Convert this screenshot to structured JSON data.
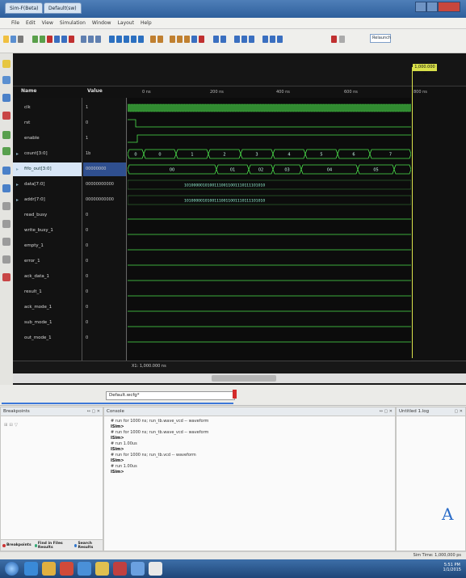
{
  "window": {
    "title": "Sim-F(Beta)",
    "tab": "Default(sw)"
  },
  "menu": [
    "File",
    "Edit",
    "View",
    "Simulation",
    "Window",
    "Layout",
    "Help"
  ],
  "toolbar": {
    "relaunch_label": "Relaunch"
  },
  "wave": {
    "name_header": "Name",
    "value_header": "Value",
    "marker_time": "1,000.000 ns",
    "ruler": [
      "0 ns",
      "200 ns",
      "400 ns",
      "600 ns",
      "800 ns"
    ],
    "cursor_readout": "X1: 1,000.000 ns",
    "signals": [
      {
        "name": "clk",
        "value": "1",
        "expandable": false,
        "selected": false
      },
      {
        "name": "rst",
        "value": "0",
        "expandable": false,
        "selected": false
      },
      {
        "name": "enable",
        "value": "1",
        "expandable": false,
        "selected": false
      },
      {
        "name": "count[3:0]",
        "value": "1b",
        "expandable": true,
        "selected": false
      },
      {
        "name": "fifo_out[3:0]",
        "value": "00000000",
        "expandable": true,
        "selected": true
      },
      {
        "name": "data[7:0]",
        "value": "00000000000",
        "expandable": true,
        "selected": false
      },
      {
        "name": "addr[7:0]",
        "value": "00000000000",
        "expandable": true,
        "selected": false
      },
      {
        "name": "read_busy",
        "value": "0",
        "expandable": false,
        "selected": false
      },
      {
        "name": "write_busy_1",
        "value": "0",
        "expandable": false,
        "selected": false
      },
      {
        "name": "empty_1",
        "value": "0",
        "expandable": false,
        "selected": false
      },
      {
        "name": "error_1",
        "value": "0",
        "expandable": false,
        "selected": false
      },
      {
        "name": "ack_data_1",
        "value": "0",
        "expandable": false,
        "selected": false
      },
      {
        "name": "result_1",
        "value": "0",
        "expandable": false,
        "selected": false
      },
      {
        "name": "ack_mode_1",
        "value": "0",
        "expandable": false,
        "selected": false
      },
      {
        "name": "sub_mode_1",
        "value": "0",
        "expandable": false,
        "selected": false
      },
      {
        "name": "out_mode_1",
        "value": "0",
        "expandable": false,
        "selected": false
      }
    ],
    "bus_count": [
      "0",
      "0",
      "1",
      "2",
      "3",
      "4",
      "5",
      "6",
      "7"
    ],
    "bus_fifo": [
      "00",
      "01",
      "02",
      "03",
      "04",
      "05"
    ],
    "bus_data": "10100000101001110011001110111101010",
    "bus_addr": "10100000101001110011001110111101010"
  },
  "lower_tabs": {
    "default_label": "Default.wcfg*"
  },
  "panes": {
    "breakpoints_title": "Breakpoints",
    "console_title": "Console",
    "objects_title": "Untitled 1.log",
    "breakpoints_icons": "⊞ ⊟ ▽",
    "console_lines": [
      {
        "text": "# run for 1000 ns; run_tb.wave_vcd -- waveform",
        "cmd": false
      },
      {
        "text": "ISim>",
        "cmd": true
      },
      {
        "text": "# run for 1000 ns; run_tb.wave_vcd -- waveform",
        "cmd": false
      },
      {
        "text": "ISim>",
        "cmd": true
      },
      {
        "text": "# run 1.00us",
        "cmd": false
      },
      {
        "text": "ISim>",
        "cmd": true
      },
      {
        "text": "# run for 1000 ns; run_tb.vcd -- waveform",
        "cmd": false
      },
      {
        "text": "ISim>",
        "cmd": true
      },
      {
        "text": "# run 1.00us",
        "cmd": false
      },
      {
        "text": "ISim>",
        "cmd": true
      }
    ],
    "bottom_tabs": [
      "Breakpoints",
      "Find in Files Results",
      "Search Results"
    ],
    "big_letter": "A"
  },
  "status": {
    "sim_time": "Sim Time: 1,000,000 ps"
  },
  "taskbar": {
    "clock_time": "5:51 PM",
    "clock_date": "1/1/2015"
  }
}
